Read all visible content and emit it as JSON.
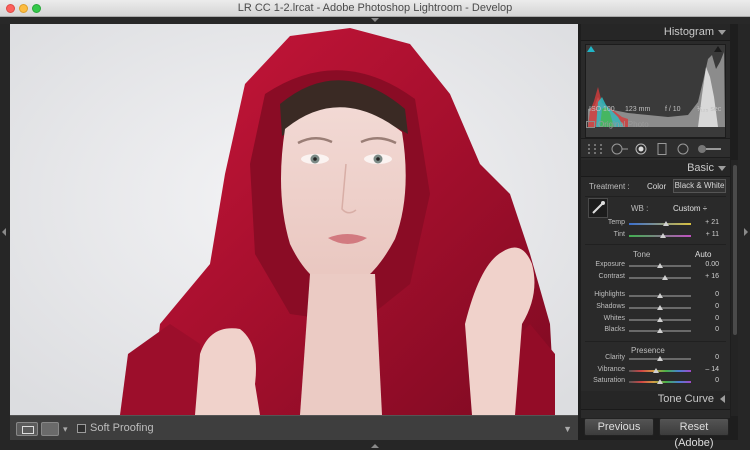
{
  "window": {
    "title": "LR CC 1-2.lrcat - Adobe Photoshop Lightroom - Develop"
  },
  "toolbar": {
    "soft_proofing_label": "Soft Proofing",
    "soft_proofing_checked": false
  },
  "histogram": {
    "title": "Histogram",
    "iso": "ISO 100",
    "focal": "123 mm",
    "aperture": "f / 10",
    "shutter": "¹⁄₁₂₅ sec",
    "original_photo_label": "Original Photo"
  },
  "basic": {
    "title": "Basic",
    "treatment_label": "Treatment :",
    "color_label": "Color",
    "bw_label": "Black & White",
    "wb_label": "WB :",
    "wb_value": "Custom ÷",
    "tone_label": "Tone",
    "auto_label": "Auto",
    "presence_label": "Presence",
    "sliders": [
      {
        "label": "Temp",
        "value": "+ 21",
        "position": 0.6,
        "style": "temp"
      },
      {
        "label": "Tint",
        "value": "+ 11",
        "position": 0.55,
        "style": "tint"
      },
      {
        "label": "Exposure",
        "value": "0.00",
        "position": 0.5,
        "style": "plain"
      },
      {
        "label": "Contrast",
        "value": "+ 16",
        "position": 0.58,
        "style": "plain"
      },
      {
        "label": "Highlights",
        "value": "0",
        "position": 0.5,
        "style": "plain"
      },
      {
        "label": "Shadows",
        "value": "0",
        "position": 0.5,
        "style": "plain"
      },
      {
        "label": "Whites",
        "value": "0",
        "position": 0.5,
        "style": "plain"
      },
      {
        "label": "Blacks",
        "value": "0",
        "position": 0.5,
        "style": "plain"
      },
      {
        "label": "Clarity",
        "value": "0",
        "position": 0.5,
        "style": "plain"
      },
      {
        "label": "Vibrance",
        "value": "– 14",
        "position": 0.43,
        "style": "vib"
      },
      {
        "label": "Saturation",
        "value": "0",
        "position": 0.5,
        "style": "sat"
      }
    ]
  },
  "tone_curve": {
    "title": "Tone Curve"
  },
  "footer": {
    "previous_label": "Previous",
    "reset_label": "Reset (Adobe)"
  },
  "colors": {
    "accent": "#20b6c8",
    "panel_bg": "#2a2a2a",
    "photo_red": "#b01030"
  }
}
